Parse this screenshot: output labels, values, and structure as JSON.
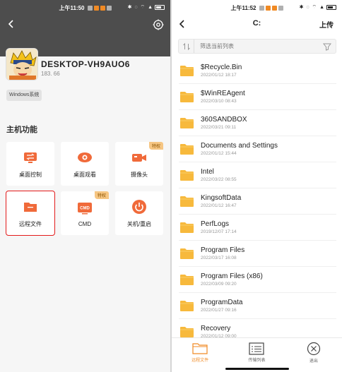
{
  "left": {
    "status": {
      "time": "上午11:50"
    },
    "device": {
      "name": "DESKTOP-VH9AUO6",
      "ip": "183.          66",
      "os_tag": "Windows系统"
    },
    "section_title": "主机功能",
    "features": [
      {
        "label": "桌面控制",
        "badge": "",
        "icon": "desktop-control-icon"
      },
      {
        "label": "桌面观看",
        "badge": "",
        "icon": "eye-icon"
      },
      {
        "label": "摄像头",
        "badge": "特权",
        "icon": "camera-icon"
      },
      {
        "label": "远程文件",
        "badge": "",
        "icon": "folder-icon"
      },
      {
        "label": "CMD",
        "badge": "特权",
        "icon": "cmd-icon"
      },
      {
        "label": "关机/重启",
        "badge": "",
        "icon": "power-icon"
      }
    ]
  },
  "right": {
    "status": {
      "time": "上午11:52"
    },
    "title": "C:",
    "upload_label": "上传",
    "filter_placeholder": "筛选当前列表",
    "files": [
      {
        "name": "$Recycle.Bin",
        "date": "2022/01/12 18:17"
      },
      {
        "name": "$WinREAgent",
        "date": "2022/03/10 08:43"
      },
      {
        "name": "360SANDBOX",
        "date": "2022/03/21 09:11"
      },
      {
        "name": "Documents and Settings",
        "date": "2022/01/12 15:44"
      },
      {
        "name": "Intel",
        "date": "2022/03/22 08:55"
      },
      {
        "name": "KingsoftData",
        "date": "2022/01/12 16:47"
      },
      {
        "name": "PerfLogs",
        "date": "2019/12/07 17:14"
      },
      {
        "name": "Program Files",
        "date": "2022/03/17 16:08"
      },
      {
        "name": "Program Files (x86)",
        "date": "2022/03/09 09:20"
      },
      {
        "name": "ProgramData",
        "date": "2022/01/27 09:16"
      },
      {
        "name": "Recovery",
        "date": "2022/01/12 09:00"
      }
    ],
    "tabs": [
      {
        "label": "远程文件",
        "icon": "folder-outline-icon",
        "active": true
      },
      {
        "label": "传输列表",
        "icon": "list-icon",
        "active": false
      },
      {
        "label": "退出",
        "icon": "close-circle-icon",
        "active": false
      }
    ]
  },
  "colors": {
    "accent": "#f08a24",
    "header_dark": "#4d4d4d",
    "folder": "#f7b93c",
    "selection": "#e31b1b"
  }
}
